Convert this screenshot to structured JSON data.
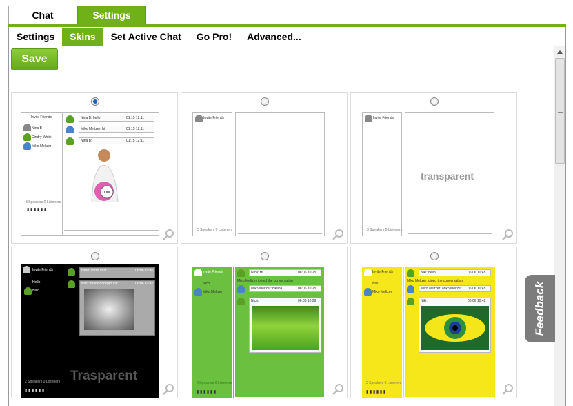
{
  "tabs": {
    "chat": "Chat",
    "settings": "Settings"
  },
  "subnav": [
    "Settings",
    "Skins",
    "Set Active Chat",
    "Go Pro!",
    "Advanced..."
  ],
  "save_label": "Save",
  "feedback_label": "Feedback",
  "colors": {
    "accent": "#6fb117",
    "selected_radio": "#1f5fb8",
    "skin_black": "#000000",
    "skin_green": "#6cc040",
    "skin_yellow": "#f5e71a"
  },
  "skins": [
    {
      "selected": true,
      "invite": "Invite Friends",
      "users": [
        "Nina B",
        "Cindry White",
        "Miko Meltzer"
      ],
      "msgs": [
        "Nina B: hello",
        "Miko Meltzer: hi",
        "Nina B:"
      ],
      "times": [
        "01:15 12:11",
        "01:15 12:11",
        "01:15 12:11"
      ],
      "footer": "3 Speakers 0 Listeners"
    },
    {
      "selected": false,
      "invite": "Invite Friends",
      "footer": "3 Speakers 0 Listeners"
    },
    {
      "selected": false,
      "invite": "Invite Friends",
      "footer": "3 Speakers 0 Listeners",
      "overlay": "transparent"
    },
    {
      "selected": false,
      "invite": "Invite Friends",
      "users": [
        "Hello",
        "Nico"
      ],
      "msgs": [
        "Hello: Hello chat",
        "Nico: Black background"
      ],
      "times": [
        "06:06 10:40",
        "06:06 10:41"
      ],
      "footer": "2 Speakers 0 Listeners",
      "overlay": "Trasparent"
    },
    {
      "selected": false,
      "invite": "Invite Friends",
      "users": [
        "Nico",
        "Miko Meltzer"
      ],
      "msgs": [
        "Nico: Hi",
        "Miko Meltzer joined the conversation",
        "Miko Meltzer: Helloa",
        "Nico:"
      ],
      "times": [
        "06:06 10:25",
        "",
        "06:06 10:25",
        "06:06 10:29"
      ],
      "footer": "2 Speakers 0 Listeners"
    },
    {
      "selected": false,
      "invite": "Invite Friends",
      "users": [
        "Niki",
        "Miko Meltzer"
      ],
      "msgs": [
        "Niki: hello",
        "Miko Meltzer joined the conversation",
        "Miko Meltzer: Miko Meltzer",
        "Niki:"
      ],
      "times": [
        "06:06 10:45",
        "",
        "06:06 10:45",
        "06:06 10:42"
      ],
      "footer": "2 Speakers 0 Listeners"
    }
  ]
}
